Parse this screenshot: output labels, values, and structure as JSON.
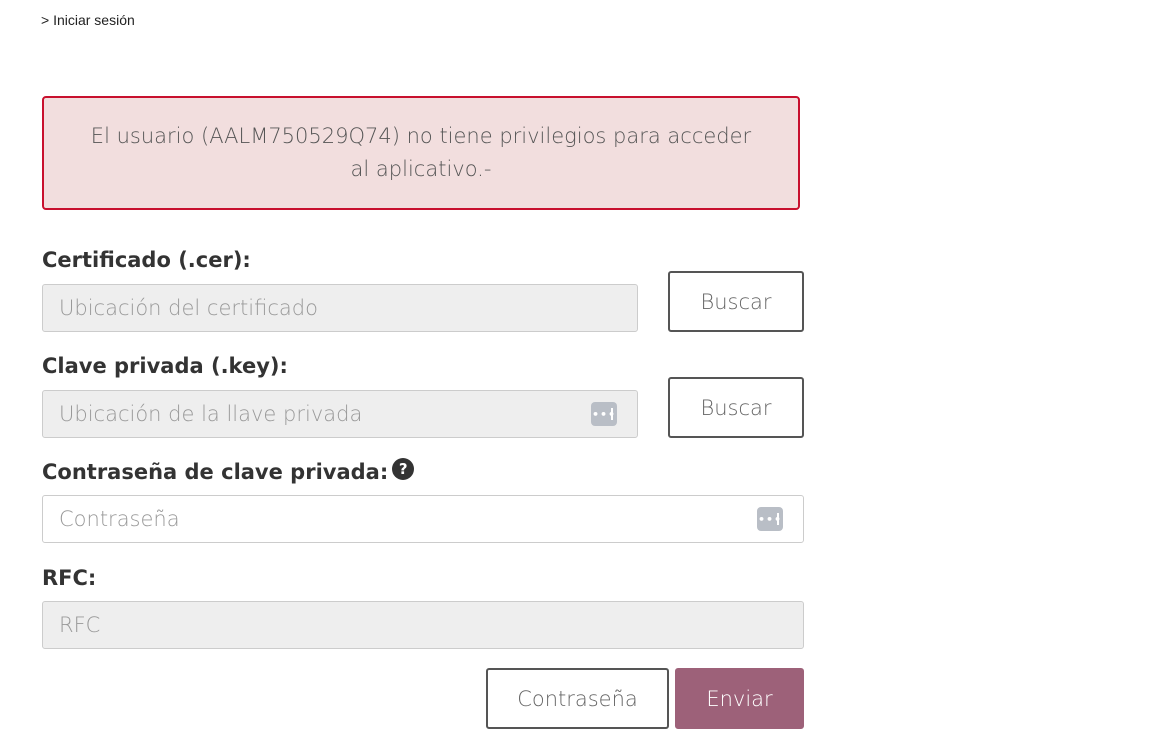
{
  "breadcrumb": {
    "text": "> Iniciar sesión"
  },
  "alert": {
    "message": "El usuario (AALM750529Q74) no tiene privilegios para acceder al aplicativo.-",
    "background_color": "#f2dede",
    "border_color": "#c8102e"
  },
  "form": {
    "certificado": {
      "label": "Certificado (.cer):",
      "placeholder": "Ubicación del certificado",
      "button_label": "Buscar"
    },
    "clave_privada": {
      "label": "Clave privada (.key):",
      "placeholder": "Ubicación de la llave privada",
      "button_label": "Buscar",
      "icon": "password-dots-icon"
    },
    "contrasena": {
      "label": "Contraseña de clave privada:",
      "help_icon": "?",
      "placeholder": "Contraseña",
      "icon": "password-dots-icon"
    },
    "rfc": {
      "label": "RFC:",
      "placeholder": "RFC"
    },
    "actions": {
      "secondary_label": "Contraseña",
      "primary_label": "Enviar",
      "primary_color": "#9d6179"
    }
  }
}
